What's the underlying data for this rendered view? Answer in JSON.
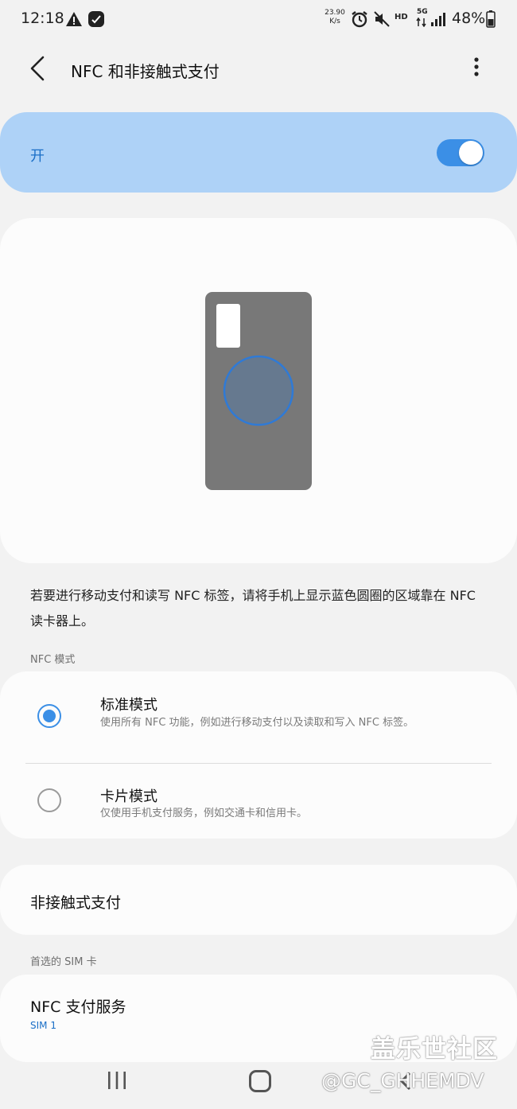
{
  "status_bar": {
    "time": "12:18",
    "net_speed_value": "23.90",
    "net_speed_unit": "K/s",
    "hd": "HD",
    "network": "5G",
    "battery": "48%"
  },
  "header": {
    "title": "NFC 和非接触式支付"
  },
  "master_switch": {
    "label": "开",
    "state": "on"
  },
  "description": "若要进行移动支付和读写 NFC 标签，请将手机上显示蓝色圆圈的区域靠在 NFC 读卡器上。",
  "nfc_mode": {
    "header": "NFC 模式",
    "options": [
      {
        "title": "标准模式",
        "subtitle": "使用所有 NFC 功能，例如进行移动支付以及读取和写入 NFC 标签。",
        "selected": true
      },
      {
        "title": "卡片模式",
        "subtitle": "仅使用手机支付服务，例如交通卡和信用卡。",
        "selected": false
      }
    ]
  },
  "contactless": {
    "label": "非接触式支付"
  },
  "sim": {
    "header": "首选的 SIM 卡",
    "row_title": "NFC 支付服务",
    "row_value": "SIM 1"
  },
  "watermark": {
    "line1": "盖乐世社区",
    "line2": "@GC_GHHEMDV"
  },
  "colors": {
    "accent": "#3b8fe6",
    "master_bg": "#aed2f7",
    "page_bg": "#f2f2f2"
  }
}
